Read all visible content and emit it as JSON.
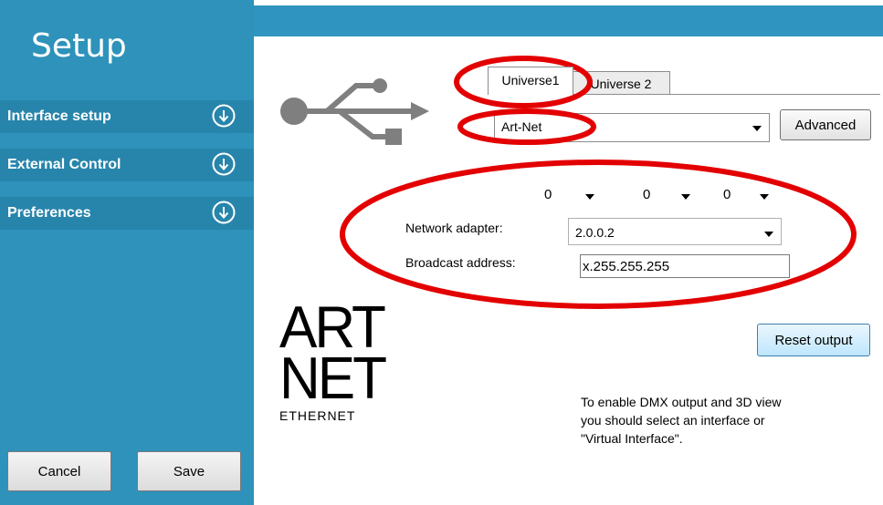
{
  "sidebar": {
    "title": "Setup",
    "items": [
      {
        "label": "Interface setup",
        "icon": "circle-down-arrow-icon"
      },
      {
        "label": "External Control",
        "icon": "circle-down-arrow-icon"
      },
      {
        "label": "Preferences",
        "icon": "circle-down-arrow-icon"
      }
    ],
    "cancel_label": "Cancel",
    "save_label": "Save"
  },
  "tabs": [
    {
      "label": "Universe1",
      "selected": true
    },
    {
      "label": "Universe 2",
      "selected": false
    }
  ],
  "protocol": {
    "value": "Art-Net",
    "icon": "usb-icon"
  },
  "advanced_label": "Advanced",
  "ip_parts": [
    "0",
    "0",
    "0"
  ],
  "network_adapter": {
    "label": "Network adapter:",
    "value": "2.0.0.2"
  },
  "broadcast": {
    "label": "Broadcast address:",
    "value": "x.255.255.255"
  },
  "logo": {
    "line1": "ART",
    "line2": "NET",
    "line3": "ETHERNET"
  },
  "reset_output_label": "Reset output",
  "info_text": "To enable DMX output and 3D view\nyou should select an interface or\n\"Virtual Interface\".",
  "colors": {
    "sidebar": "#2e92ba",
    "sidebar_item": "#2785ab",
    "top_strip": "#2f95c0",
    "annotation": "#e30000"
  }
}
